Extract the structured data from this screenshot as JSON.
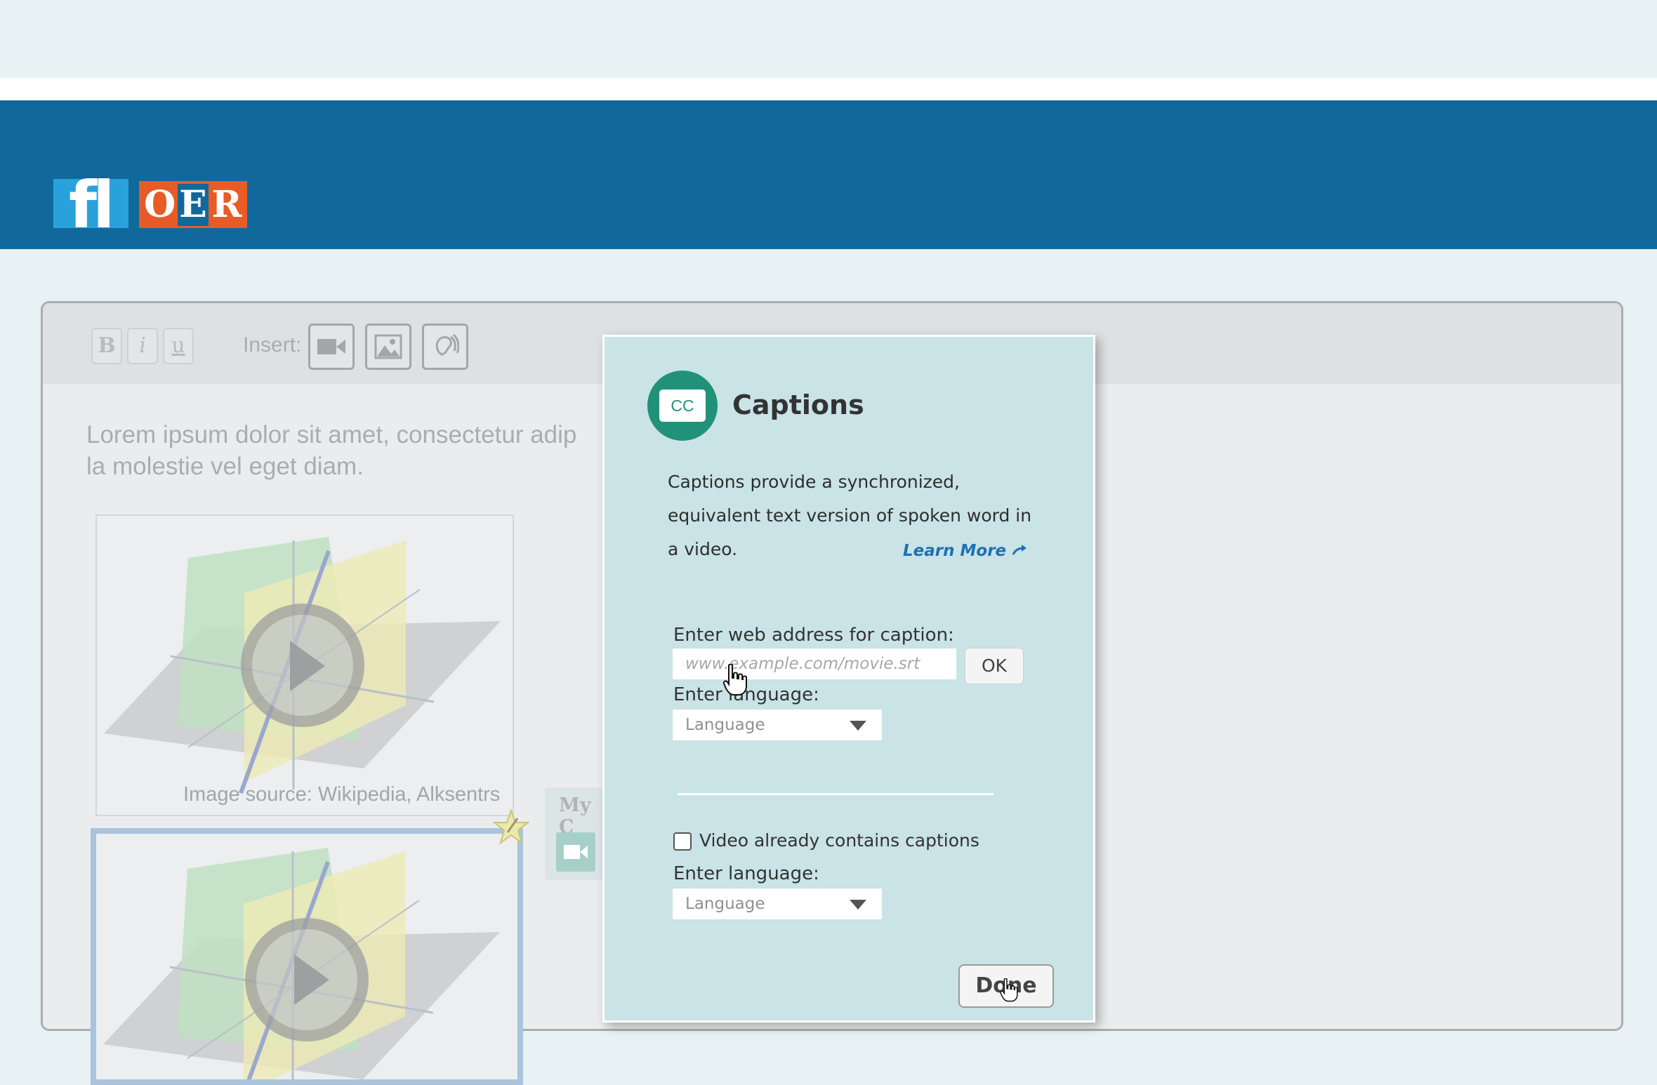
{
  "brand": {
    "logo_primary": "fl",
    "logo_secondary": [
      "O",
      "E",
      "R"
    ],
    "colors": {
      "header": "#11689c",
      "logo_blue": "#29a2dc",
      "logo_orange": "#e75b27",
      "accent_green": "#22917a",
      "link": "#1d71b3"
    }
  },
  "toolbar": {
    "bold": "B",
    "italic": "i",
    "underline": "u",
    "insert_label": "Insert:",
    "insert_buttons": [
      "video-icon",
      "image-icon",
      "audio-icon"
    ]
  },
  "content": {
    "paragraph_line1": "Lorem ipsum dolor sit amet, consectetur adip",
    "paragraph_line2": "la molestie vel eget diam.",
    "image_caption": "Image source: Wikipedia, Alksentrs",
    "tray_label": "My C"
  },
  "dialog": {
    "badge": "CC",
    "title": "Captions",
    "description": "Captions provide a synchronized, equivalent text version of spoken word in a video.",
    "learn_more": "Learn More",
    "url_label": "Enter web address for caption:",
    "url_placeholder": "www.example.com/movie.srt",
    "url_value": "",
    "ok_label": "OK",
    "language_label_1": "Enter language:",
    "language_select_1": "Language",
    "checkbox_label": "Video already contains captions",
    "checkbox_checked": false,
    "language_label_2": "Enter language:",
    "language_select_2": "Language",
    "done_label": "Done"
  }
}
